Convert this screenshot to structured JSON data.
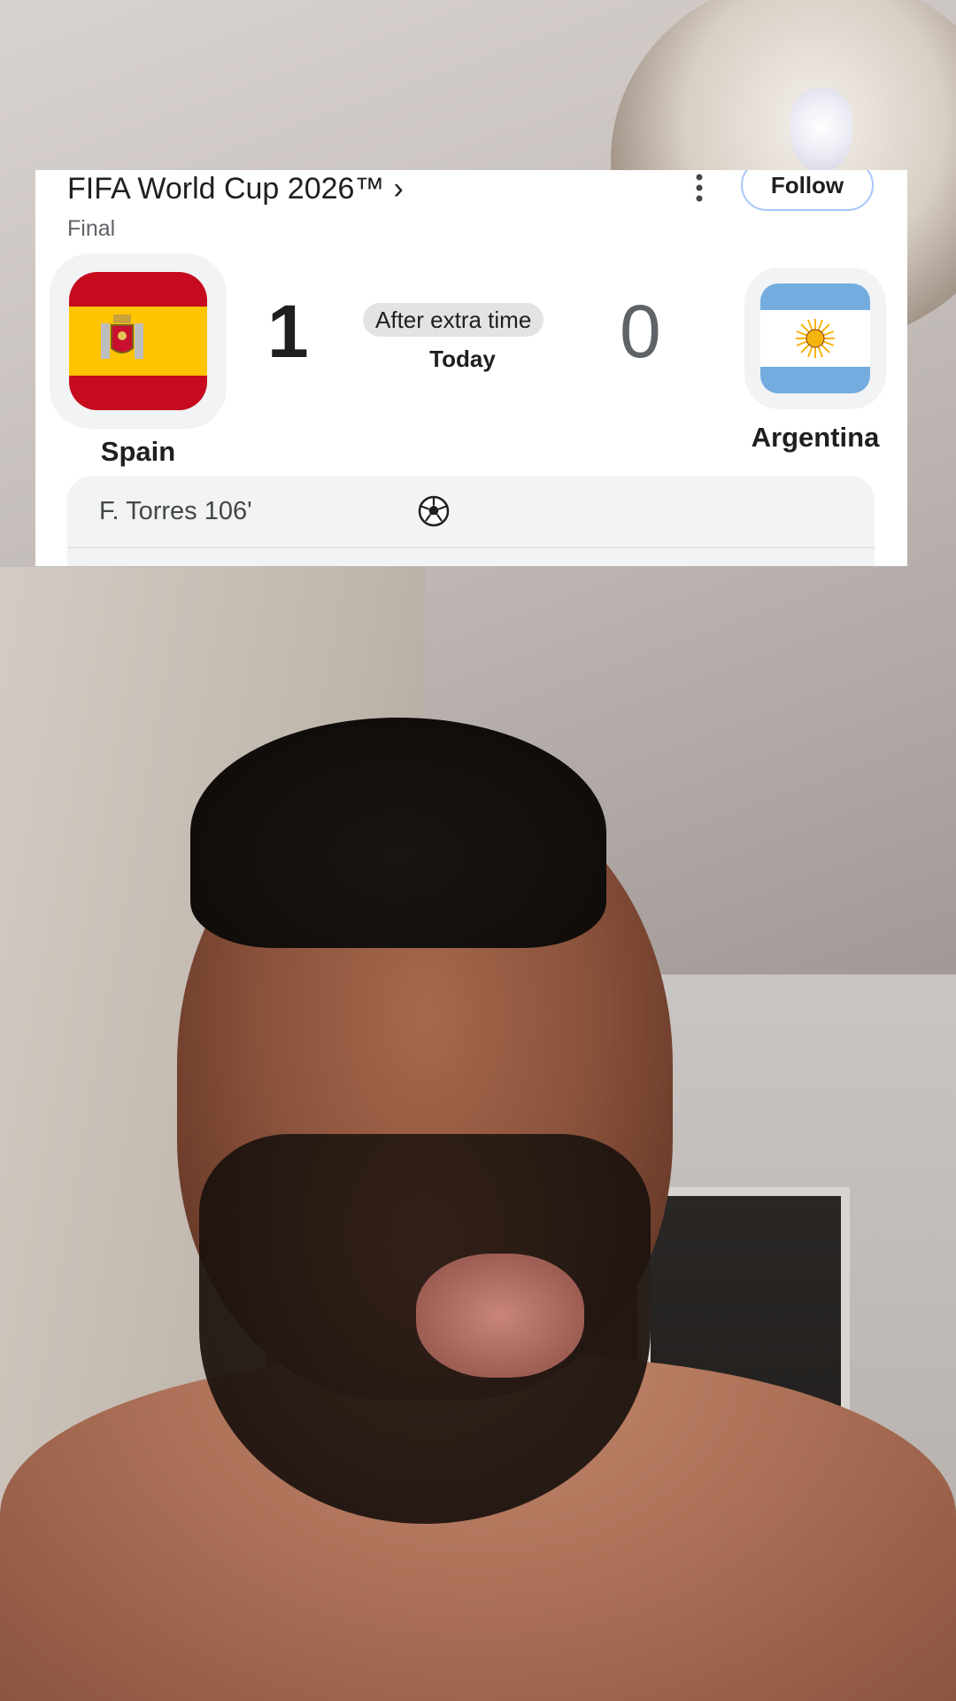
{
  "card": {
    "competition": "FIFA World Cup 2026™",
    "competition_chevron": "›",
    "stage": "Final",
    "more_icon": "more-vertical-icon",
    "follow_label": "Follow",
    "status": "After extra time",
    "date": "Today",
    "home": {
      "name": "Spain",
      "score": "1",
      "flag_colors": [
        "#c60b1e",
        "#ffc400",
        "#c60b1e"
      ]
    },
    "away": {
      "name": "Argentina",
      "score": "0",
      "flag_colors": [
        "#74acdf",
        "#ffffff",
        "#74acdf"
      ],
      "sun_color": "#f6b40e"
    },
    "events": [
      {
        "player": "F. Torres 106'",
        "icon": "soccer-ball-icon"
      }
    ]
  }
}
